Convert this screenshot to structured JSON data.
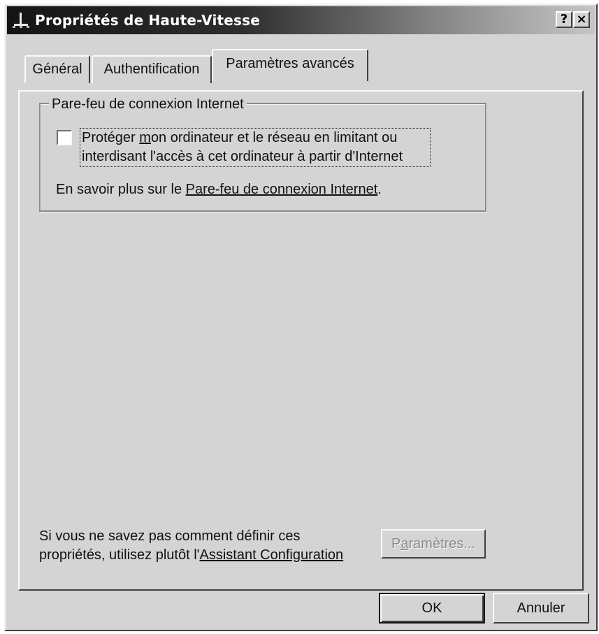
{
  "window": {
    "title": "Propriétés de Haute-Vitesse",
    "help_button": "?",
    "close_button": "×",
    "icon": "network-connection-icon"
  },
  "tabs": [
    {
      "label": "Général",
      "active": false
    },
    {
      "label": "Authentification",
      "active": false
    },
    {
      "label": "Paramètres avancés",
      "active": true
    }
  ],
  "firewall_group": {
    "legend": "Pare-feu de connexion Internet",
    "checkbox_checked": false,
    "checkbox_label_line1_pre": "Protéger ",
    "checkbox_label_line1_mnemonic": "m",
    "checkbox_label_line1_post": "on ordinateur et le réseau en limitant ou",
    "checkbox_label_line2": "interdisant l'accès à cet ordinateur à partir d'Internet",
    "learn_more_prefix": "En savoir plus sur le ",
    "learn_more_link": "Pare-feu de connexion Internet",
    "learn_more_suffix": "."
  },
  "help": {
    "line1": "Si vous ne savez pas comment définir ces",
    "line2_prefix": "propriétés, utilisez plutôt l'",
    "line2_link": "Assistant Configuration"
  },
  "buttons": {
    "settings_pre": "P",
    "settings_mnemonic": "a",
    "settings_post": "ramètres...",
    "settings_enabled": false,
    "ok": "OK",
    "cancel": "Annuler"
  },
  "colors": {
    "dialog_face": "#d4d4d4",
    "titlebar_start": "#141414",
    "titlebar_end": "#c6c6c6",
    "disabled_text": "#8c8c8c"
  }
}
